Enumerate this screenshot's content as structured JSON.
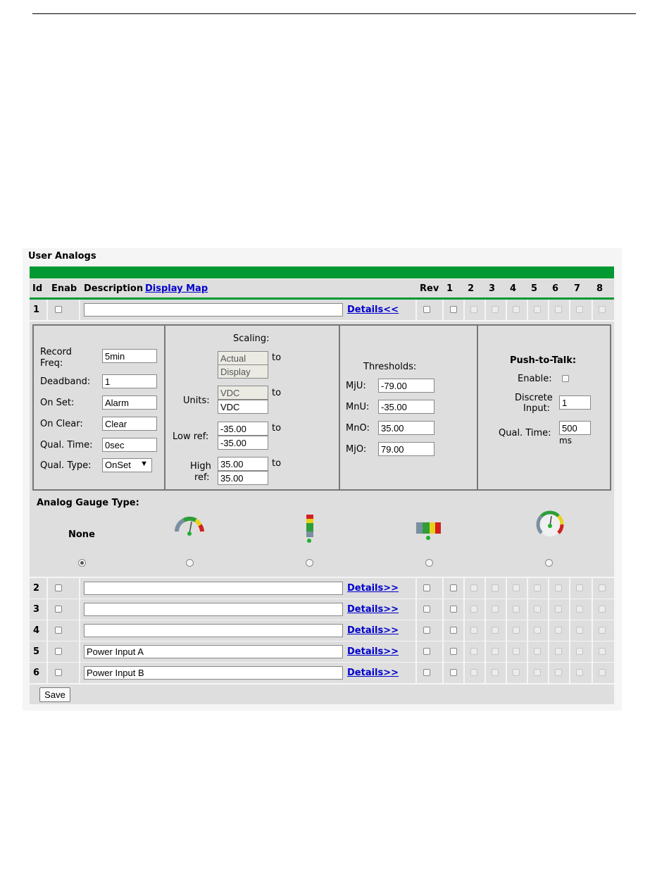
{
  "panel": {
    "title": "User Analogs",
    "headers": {
      "id": "Id",
      "enab": "Enab",
      "description": "Description",
      "display_map": "Display Map",
      "rev": "Rev",
      "cols": [
        "1",
        "2",
        "3",
        "4",
        "5",
        "6",
        "7",
        "8"
      ]
    }
  },
  "rows": [
    {
      "id": "1",
      "description": "",
      "details": "Details<<"
    },
    {
      "id": "2",
      "description": "",
      "details": "Details>>"
    },
    {
      "id": "3",
      "description": "",
      "details": "Details>>"
    },
    {
      "id": "4",
      "description": "",
      "details": "Details>>"
    },
    {
      "id": "5",
      "description": "Power Input A",
      "details": "Details>>"
    },
    {
      "id": "6",
      "description": "Power Input B",
      "details": "Details>>"
    }
  ],
  "details": {
    "record_freq_label": "Record Freq:",
    "record_freq": "5min",
    "deadband_label": "Deadband:",
    "deadband": "1",
    "on_set_label": "On Set:",
    "on_set": "Alarm",
    "on_clear_label": "On Clear:",
    "on_clear": "Clear",
    "qual_time_label": "Qual. Time:",
    "qual_time": "0sec",
    "qual_type_label": "Qual. Type:",
    "qual_type": "OnSet",
    "scaling": {
      "title": "Scaling:",
      "actual": "Actual",
      "display": "Display",
      "to": "to",
      "units_label": "Units:",
      "units_actual": "VDC",
      "units_display": "VDC",
      "low_ref_label": "Low ref:",
      "low_ref_actual": "-35.00",
      "low_ref_display": "-35.00",
      "high_ref_label_1": "High",
      "high_ref_label_2": "ref:",
      "high_ref_actual": "35.00",
      "high_ref_display": "35.00"
    },
    "thresholds": {
      "title": "Thresholds:",
      "mju_label": "MjU:",
      "mju": "-79.00",
      "mnu_label": "MnU:",
      "mnu": "-35.00",
      "mno_label": "MnO:",
      "mno": "35.00",
      "mjo_label": "MjO:",
      "mjo": "79.00"
    },
    "ptt": {
      "title": "Push-to-Talk:",
      "enable_label": "Enable:",
      "discrete_label_1": "Discrete",
      "discrete_label_2": "Input:",
      "discrete_input": "1",
      "qual_time_label": "Qual. Time:",
      "qual_time": "500",
      "qual_time_unit": "ms"
    }
  },
  "gauge": {
    "title": "Analog Gauge Type:",
    "none_label": "None",
    "selected": "none",
    "options": [
      "none-option",
      "semicircle-gauge-icon",
      "vertical-bar-gauge-icon",
      "horizontal-bar-gauge-icon",
      "round-gauge-icon"
    ]
  },
  "save_label": "Save",
  "colors": {
    "accent_green": "#009933",
    "link_blue": "#0000cc",
    "panel_gray": "#dedede"
  }
}
